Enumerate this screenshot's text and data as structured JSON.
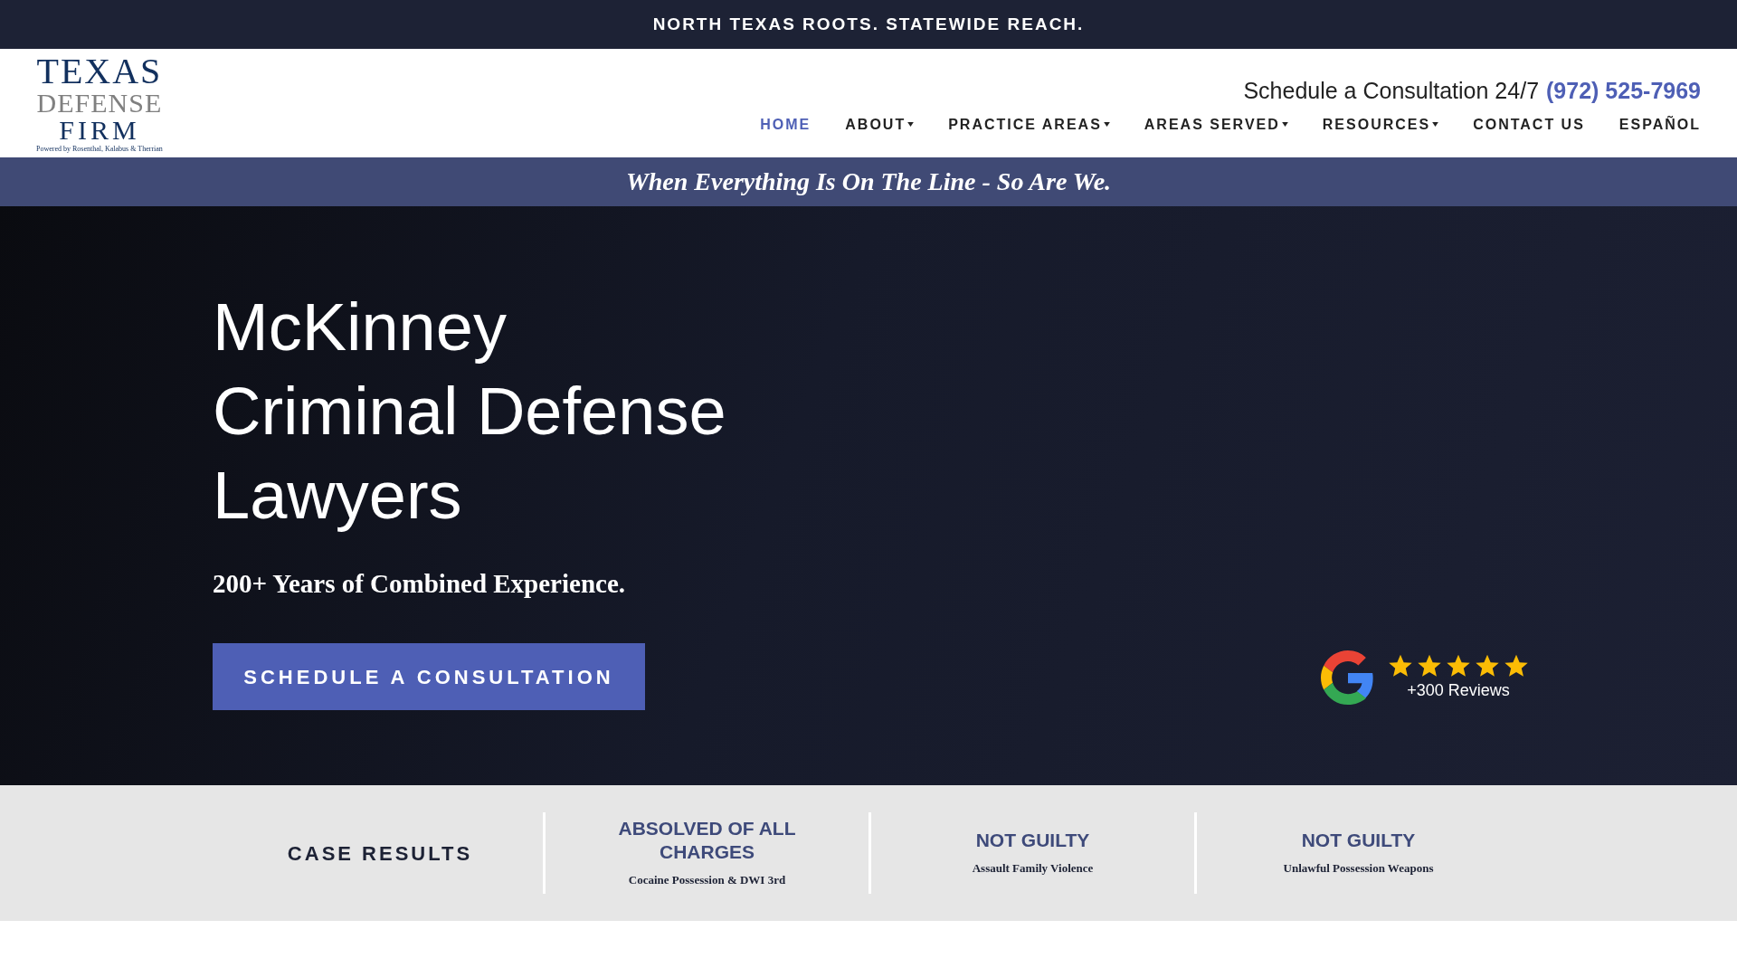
{
  "top_bar": {
    "text": "NORTH TEXAS ROOTS. STATEWIDE REACH."
  },
  "logo": {
    "line_1": "TEXAS",
    "line_2": "DEFENSE",
    "line_3": "FIRM",
    "tagline": "Powered by Rosenthal, Kalabus & Therrian"
  },
  "contact": {
    "label": "Schedule a Consultation 24/7",
    "phone": "(972) 525-7969"
  },
  "nav": [
    {
      "label": "HOME",
      "selected": true,
      "dropdown": false
    },
    {
      "label": "ABOUT",
      "selected": false,
      "dropdown": true
    },
    {
      "label": "PRACTICE AREAS",
      "selected": false,
      "dropdown": true
    },
    {
      "label": "AREAS SERVED",
      "selected": false,
      "dropdown": true
    },
    {
      "label": "RESOURCES",
      "selected": false,
      "dropdown": true
    },
    {
      "label": "CONTACT US",
      "selected": false,
      "dropdown": false
    },
    {
      "label": "ESPAÑOL",
      "selected": false,
      "dropdown": false
    }
  ],
  "slogan": "When Everything Is On The Line - So Are We.",
  "hero": {
    "title_lines": [
      "McKinney",
      "Criminal Defense",
      "Lawyers"
    ],
    "subtitle": "200+ Years of Combined Experience.",
    "button": "SCHEDULE A CONSULTATION",
    "reviews": {
      "stars": 5,
      "text": "+300 Reviews"
    }
  },
  "case_results": {
    "heading": "CASE RESULTS",
    "items": [
      {
        "verdict": "ABSOLVED OF ALL CHARGES",
        "charge": "Cocaine Possession & DWI 3rd"
      },
      {
        "verdict": "NOT GUILTY",
        "charge": "Assault Family Violence"
      },
      {
        "verdict": "NOT GUILTY",
        "charge": "Unlawful Possession Weapons"
      }
    ]
  }
}
